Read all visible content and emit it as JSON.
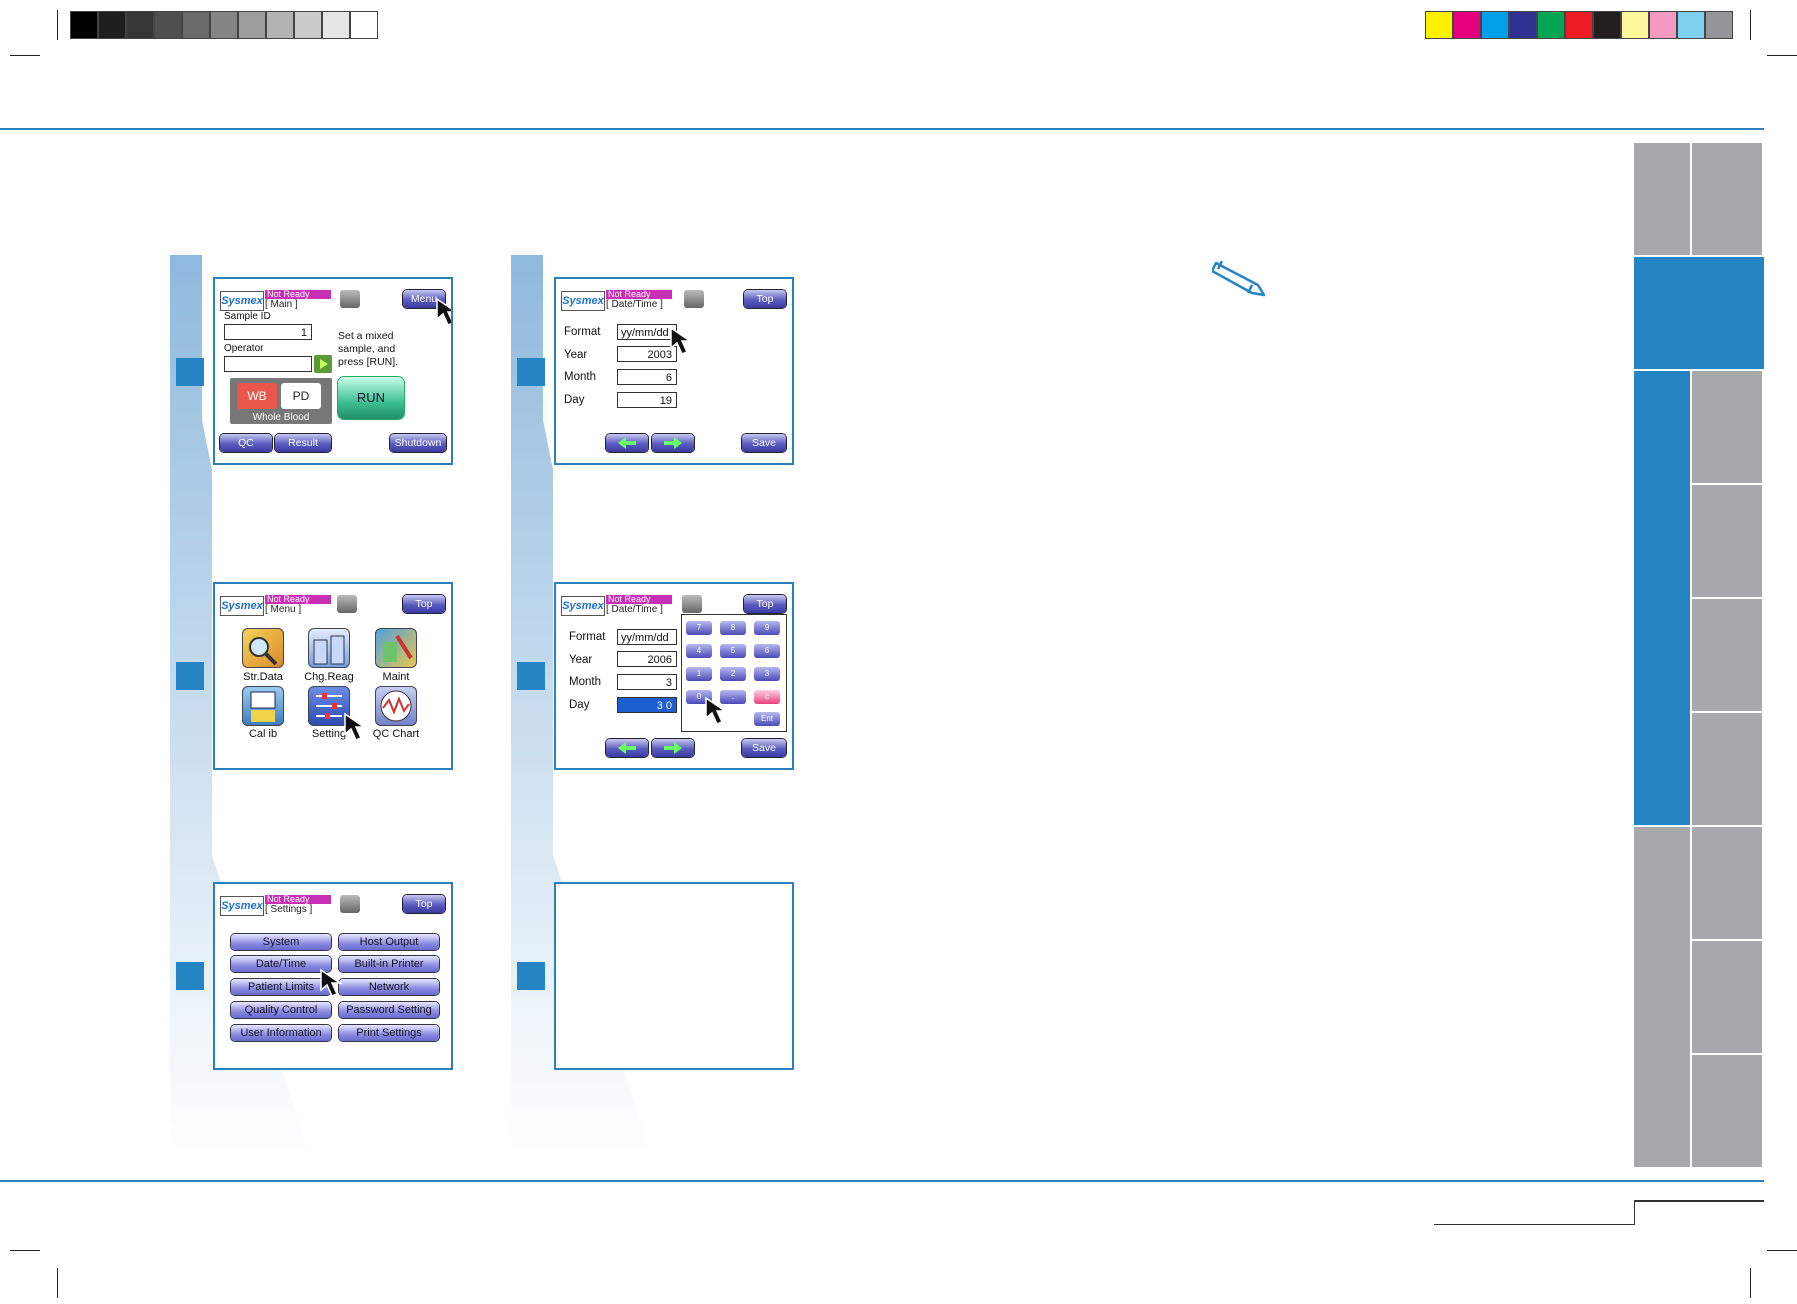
{
  "colors": {
    "accent": "#2584c3",
    "grey_tab": "#a7a9ac",
    "status_magenta": "#c92fb5",
    "wb_red": "#e8574a",
    "run_green": "#3fbf8f"
  },
  "print_marks": {
    "gray_ramp": [
      "#000000",
      "#1e1e1e",
      "#363636",
      "#4f4f4f",
      "#696969",
      "#858585",
      "#9d9d9d",
      "#b3b3b3",
      "#cbcbcb",
      "#e6e6e6",
      "#ffffff"
    ],
    "color_bar": [
      "#fff100",
      "#e6007e",
      "#00a0e9",
      "#2e3192",
      "#00a651",
      "#ed1c24",
      "#231f20",
      "#fff799",
      "#f49ac1",
      "#7dd0f0",
      "#939598"
    ]
  },
  "note_icon": "pencil-icon",
  "cursor_icon": "arrow-cursor-icon",
  "screens": {
    "main": {
      "logo": "Sysmex",
      "status": "Not Ready",
      "title": "[    Main    ]",
      "menu_btn": "Menu",
      "sample_id_label": "Sample ID",
      "sample_id_value": "1",
      "operator_label": "Operator",
      "instruction": [
        "Set a mixed",
        "sample, and",
        "press [RUN]."
      ],
      "wb": "WB",
      "pd": "PD",
      "mode_caption": "Whole Blood",
      "run": "RUN",
      "qc": "QC",
      "result": "Result",
      "shutdown": "Shutdown"
    },
    "menu": {
      "logo": "Sysmex",
      "status": "Not Ready",
      "title": "[    Menu    ]",
      "top_btn": "Top",
      "icons": [
        {
          "label": "Str.Data",
          "icon": "magnifier-folder-icon"
        },
        {
          "label": "Chg.Reag",
          "icon": "reagent-bottles-icon"
        },
        {
          "label": "Maint",
          "icon": "maintenance-icon"
        },
        {
          "label": "Cal ib",
          "icon": "calibration-icon"
        },
        {
          "label": "Setting",
          "icon": "sliders-icon"
        },
        {
          "label": "QC Chart",
          "icon": "qc-chart-icon"
        }
      ]
    },
    "settings": {
      "logo": "Sysmex",
      "status": "Not Ready",
      "title": "[  Settings  ]",
      "top_btn": "Top",
      "buttons": [
        "System",
        "Host Output",
        "Date/Time",
        "Built-in Printer",
        "Patient Limits",
        "Network",
        "Quality Control",
        "Password Setting",
        "User Information",
        "Print Settings"
      ]
    },
    "datetime1": {
      "logo": "Sysmex",
      "status": "Not Ready",
      "title": "[ Date/Time ]",
      "top_btn": "Top",
      "labels": [
        "Format",
        "Year",
        "Month",
        "Day"
      ],
      "values": [
        "yy/mm/dd",
        "2003",
        "6",
        "19"
      ],
      "save": "Save"
    },
    "datetime2": {
      "logo": "Sysmex",
      "status": "Not Ready",
      "title": "[ Date/Time ]",
      "top_btn": "Top",
      "labels": [
        "Format",
        "Year",
        "Month",
        "Day"
      ],
      "values": [
        "yy/mm/dd",
        "2006",
        "3",
        "3 0"
      ],
      "save": "Save",
      "keypad": [
        "7",
        "8",
        "9",
        "4",
        "5",
        "6",
        "1",
        "2",
        "3",
        "0",
        ".",
        "c",
        "Ent"
      ]
    }
  }
}
